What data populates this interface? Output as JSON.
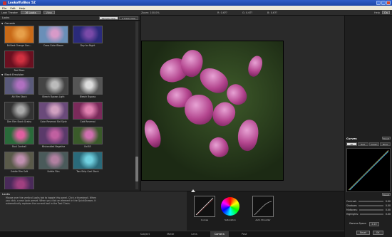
{
  "window": {
    "title": "LookoffulBox 5Z",
    "min_icon": "minimize-icon",
    "max_icon": "maximize-icon",
    "close_icon": "close-icon"
  },
  "menu": [
    "File",
    "Edit",
    "Help"
  ],
  "toolbar": {
    "look_label": "Look Theater",
    "look_value": "16 Looks",
    "view_label": "View",
    "zoom": "Zoom: 100.0%",
    "r": "R: 0.6??",
    "g": "G: 0.6??",
    "b": "B: 0.6??",
    "help_label": "Help",
    "help_value": "On"
  },
  "left_panel": {
    "title": "Looks",
    "tabs": [
      "Sample View",
      "A Trash View"
    ],
    "categories": [
      {
        "name": "Gonzalo",
        "items": [
          "Brilliant Orange Gon...",
          "Cross Color Bloom",
          "Day for Night",
          "Red Stars"
        ]
      },
      {
        "name": "Black Emulsion",
        "items": [
          "Alt Film Stock",
          "Bleach Bypass Light",
          "Bleach Bypass",
          "Dim Film Stock Grainy",
          "Color Reversal Std Style",
          "Cold Reversal",
          "Ruul Contrail",
          "Mishandled Negative",
          "Nd 85",
          "Subtle Film Soft",
          "Subtle Film",
          "Two Strip Cool Stock",
          "Warm Stock 01"
        ]
      },
      {
        "name": "Tints",
        "items": [
          "Cool Deep Blue",
          "Cool Sky",
          "Cool Sunset"
        ]
      }
    ]
  },
  "help": {
    "title": "Looks",
    "text": "Mouse over the vertical Looks tab to toggle this panel. Click a thumbnail. When you click, a new Look preset. When you click an element in the QuickDrawer, it automatically replaces the current tool in the Tool Chain."
  },
  "tools": [
    {
      "label": "Curves"
    },
    {
      "label": "Saturation"
    },
    {
      "label": "Auto Shoulder"
    }
  ],
  "bottom_tabs": [
    "Subject",
    "Matte",
    "Lens",
    "Camera",
    "Post"
  ],
  "bottom_active": "Camera",
  "right_panel": {
    "title": "Curves",
    "reset": "Reset",
    "channels": [
      "All",
      "Red",
      "Green",
      "Blue"
    ],
    "channel_active": "All",
    "sliders": [
      {
        "label": "Contrast:",
        "value": "0.00"
      },
      {
        "label": "Shadows:",
        "value": "0.00"
      },
      {
        "label": "Midtones:",
        "value": "0.00"
      },
      {
        "label": "Highlights:",
        "value": "0.00"
      }
    ],
    "gamma_label": "Gamma Space:",
    "gamma_value": "2.20",
    "buttons": [
      "Reset",
      "OK"
    ]
  },
  "colors": {
    "titlebar": "#2f5ec8",
    "accent": "#d0d0d0"
  }
}
